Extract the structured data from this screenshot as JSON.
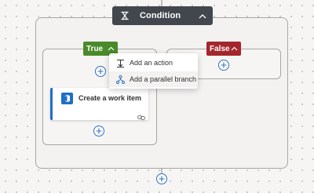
{
  "condition": {
    "title": "Condition",
    "icon": "condition-icon",
    "chevron_icon": "chevron-up-icon"
  },
  "branches": {
    "true_label": "True",
    "false_label": "False",
    "tag_chevron_icon": "chevron-up-icon"
  },
  "menu": {
    "items": [
      {
        "label": "Add an action",
        "icon": "add-action-icon"
      },
      {
        "label": "Add a parallel branch",
        "icon": "parallel-branch-icon"
      }
    ]
  },
  "action_card": {
    "title": "Create a work item",
    "icon": "azure-devops-icon",
    "link_icon": "link-icon"
  },
  "colors": {
    "header_bg": "#42474d",
    "true_tag": "#4a8a2a",
    "false_tag": "#a4262c",
    "accent_blue": "#1f6fc6"
  }
}
